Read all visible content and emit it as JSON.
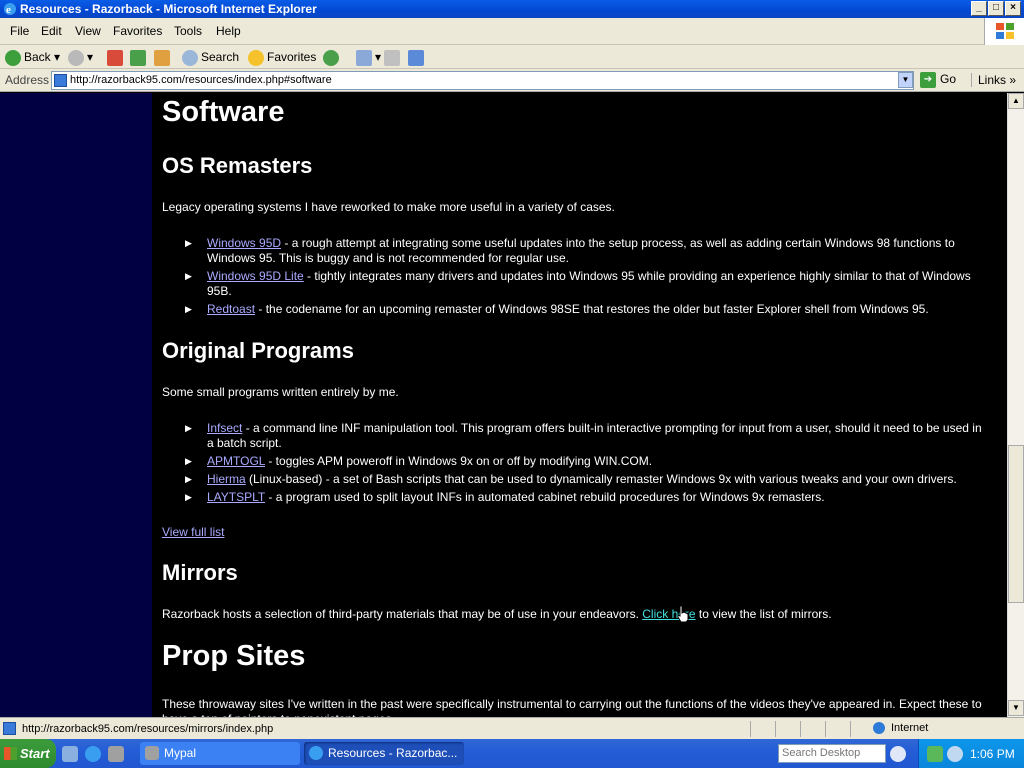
{
  "window": {
    "title": "Resources - Razorback - Microsoft Internet Explorer",
    "controls": [
      "_",
      "□",
      "×"
    ]
  },
  "menu": [
    "File",
    "Edit",
    "View",
    "Favorites",
    "Tools",
    "Help"
  ],
  "toolbar": {
    "back": "Back",
    "search": "Search",
    "favorites": "Favorites"
  },
  "address": {
    "label": "Address",
    "url": "http://razorback95.com/resources/index.php#software",
    "go": "Go",
    "links": "Links"
  },
  "page": {
    "h_software": "Software",
    "h_os_remasters": "OS Remasters",
    "os_intro": "Legacy operating systems I have reworked to make more useful in a variety of cases.",
    "os_items": [
      {
        "link": "Windows 95D",
        "text": " - a rough attempt at integrating some useful updates into the setup process, as well as adding certain Windows 98 functions to Windows 95. This is buggy and is not recommended for regular use."
      },
      {
        "link": "Windows 95D Lite",
        "text": " - tightly integrates many drivers and updates into Windows 95 while providing an experience highly similar to that of Windows 95B."
      },
      {
        "link": "Redtoast",
        "text": " - the codename for an upcoming remaster of Windows 98SE that restores the older but faster Explorer shell from Windows 95."
      }
    ],
    "h_original": "Original Programs",
    "orig_intro": "Some small programs written entirely by me.",
    "orig_items": [
      {
        "link": "Infsect",
        "text": " - a command line INF manipulation tool. This program offers built-in interactive prompting for input from a user, should it need to be used in a batch script."
      },
      {
        "link": "APMTOGL",
        "text": " - toggles APM poweroff in Windows 9x on or off by modifying WIN.COM."
      },
      {
        "link": "Hierma",
        "text": " (Linux-based) - a set of Bash scripts that can be used to dynamically remaster Windows 9x with various tweaks and your own drivers."
      },
      {
        "link": "LAYTSPLT",
        "text": " - a program used to split layout INFs in automated cabinet rebuild procedures for Windows 9x remasters."
      }
    ],
    "view_full": "View full list",
    "h_mirrors": "Mirrors",
    "mirrors_pre": "Razorback hosts a selection of third-party materials that may be of use in your endeavors. ",
    "mirrors_link": "Click here",
    "mirrors_post": " to view the list of mirrors.",
    "h_prop": "Prop Sites",
    "prop_text": "These throwaway sites I've written in the past were specifically instrumental to carrying out the functions of the videos they've appeared in. Expect these to have a ton of pointers to nonexistent pages."
  },
  "status": {
    "text": "http://razorback95.com/resources/mirrors/index.php",
    "zone": "Internet"
  },
  "taskbar": {
    "start": "Start",
    "tasks": [
      "Mypal",
      "Resources - Razorbac..."
    ],
    "search_placeholder": "Search Desktop",
    "clock": "1:06 PM"
  },
  "colors": {
    "link": "#aaaaff",
    "link_hover": "#44e0e0",
    "sidebar": "#000042",
    "background": "#000000"
  }
}
